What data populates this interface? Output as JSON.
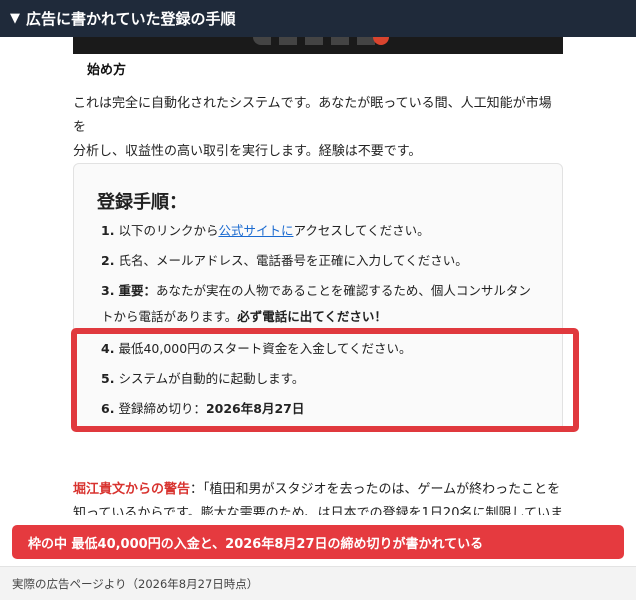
{
  "header": {
    "toggle_icon": "triangle-down-icon",
    "title": "広告に書かれていた登録の手順"
  },
  "video": {
    "caption": "始め方"
  },
  "intro": {
    "line1": "これは完全に自動化されたシステムです。あなたが眠っている間、人工知能が市場を",
    "line2": "分析し、収益性の高い取引を実行します。経験は不要です。"
  },
  "registration": {
    "title": "登録手順：",
    "steps": [
      {
        "num": "1.",
        "pre": "以下のリンクから",
        "link": "公式サイトに",
        "post": "アクセスしてください。"
      },
      {
        "num": "2.",
        "text": "氏名、メールアドレス、電話番号を正確に入力してください。"
      },
      {
        "num": "3.",
        "bold_lead": "重要：",
        "text1": "あなたが実在の人物であることを確認するため、個人コンサルタン",
        "text2": "トから電話があります。",
        "bold_tail": "必ず電話に出てください！"
      },
      {
        "num": "4.",
        "text": "最低40,000円のスタート資金を入金してください。"
      },
      {
        "num": "5.",
        "text": "システムが自動的に起動します。"
      },
      {
        "num": "6.",
        "pre": "登録締め切り：",
        "bold_date": "2026年8月27日"
      }
    ]
  },
  "warning": {
    "name": "堀江貴文からの警告",
    "line1": "：「植田和男がスタジオを去ったのは、ゲームが終わったことを",
    "line2": "知っているからです。膨大な需要のため、は日本での登録を1日20名に制限していま"
  },
  "banner": {
    "text": "枠の中 最低40,000円の入金と、2026年8月27日の締め切りが書かれている"
  },
  "footer": {
    "text": "実際の広告ページより（2026年8月27日時点）"
  },
  "colors": {
    "header_bg": "#1f2a3a",
    "highlight": "#e0393e",
    "banner_bg": "#e53a3f",
    "link": "#1a6ad0",
    "warning_name": "#d8332f"
  }
}
